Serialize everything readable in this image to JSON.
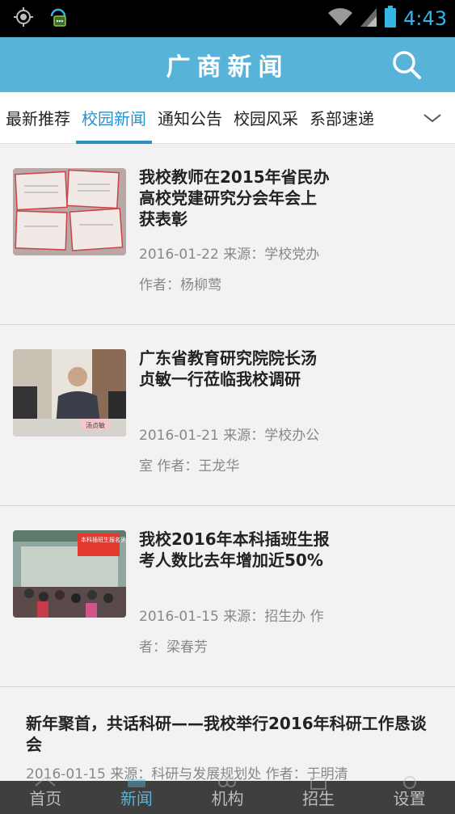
{
  "status": {
    "time": "4:43",
    "icons": [
      "gps-icon",
      "notification-icon",
      "wifi-icon",
      "signal-icon",
      "battery-icon"
    ],
    "time_color": "#33b5e5"
  },
  "header": {
    "title": "广商新闻",
    "search_icon": "search-icon",
    "bg_color": "#58b3d9"
  },
  "tabs": [
    {
      "label": "最新推荐",
      "active": false
    },
    {
      "label": "校园新闻",
      "active": true
    },
    {
      "label": "通知公告",
      "active": false
    },
    {
      "label": "校园风采",
      "active": false
    },
    {
      "label": "系部速递",
      "active": false
    }
  ],
  "tabs_more_icon": "chevron-down-icon",
  "news": [
    {
      "title": "我校教师在2015年省民办高校党建研究分会年会上获表彰",
      "meta": "2016-01-22  来源：学校党办  作者：杨柳莺",
      "thumb": "certificates-photo"
    },
    {
      "title": "广东省教育研究院院长汤贞敏一行莅临我校调研",
      "meta": "2016-01-21  来源：学校办公室  作者：王龙华",
      "thumb": "meeting-photo",
      "thumb_caption": "汤贞敏"
    },
    {
      "title": "我校2016年本科插班生报考人数比去年增加近50%",
      "meta": "2016-01-15  来源：招生办  作者：梁春芳",
      "thumb": "crowd-photo",
      "thumb_caption": "本科插班生报名确认处"
    },
    {
      "title": "新年聚首，共话科研——我校举行2016年科研工作恳谈会",
      "meta": "2016-01-15  来源：科研与发展规划处  作者：于明清"
    }
  ],
  "bottom_nav": [
    {
      "label": "首页",
      "icon": "home-icon",
      "active": false
    },
    {
      "label": "新闻",
      "icon": "news-icon",
      "active": true
    },
    {
      "label": "机构",
      "icon": "org-icon",
      "active": false
    },
    {
      "label": "招生",
      "icon": "enroll-icon",
      "active": false
    },
    {
      "label": "设置",
      "icon": "settings-icon",
      "active": false
    }
  ]
}
